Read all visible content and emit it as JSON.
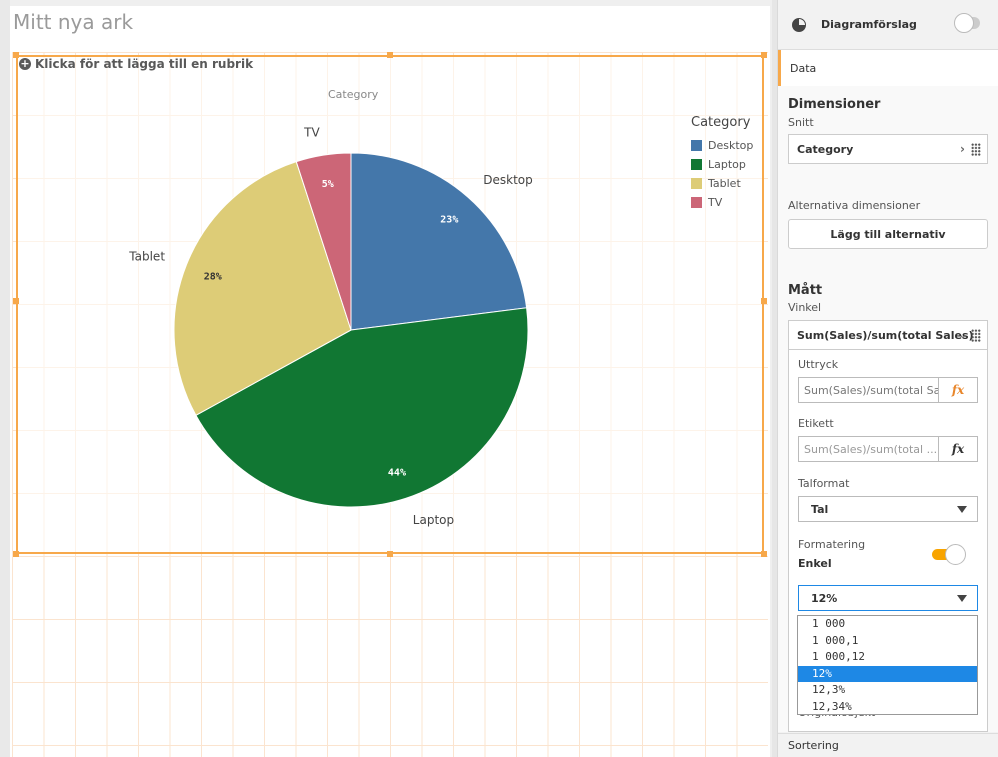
{
  "sheet": {
    "title": "Mitt nya ark"
  },
  "chart": {
    "add_title_label": "Klicka för att lägga till en rubrik",
    "dimension_label": "Category",
    "legend_title": "Category"
  },
  "chart_data": {
    "type": "pie",
    "title": "",
    "categories": [
      "Desktop",
      "Laptop",
      "Tablet",
      "TV"
    ],
    "values": [
      23,
      44,
      28,
      5
    ],
    "value_labels": [
      "23%",
      "44%",
      "28%",
      "5%"
    ],
    "colors": [
      "#4477aa",
      "#117733",
      "#ddcc77",
      "#cc6677"
    ],
    "legend_placement": "top-right"
  },
  "panel": {
    "suggestions_label": "Diagramförslag",
    "data_tab": "Data",
    "dimensions_heading": "Dimensioner",
    "dimensions_sub": "Snitt",
    "dimension_value": "Category",
    "alt_dimensions_label": "Alternativa dimensioner",
    "add_alt_button": "Lägg till alternativ",
    "measures_heading": "Mått",
    "measures_sub": "Vinkel",
    "measure_value": "Sum(Sales)/sum(total Sales)",
    "expression_label": "Uttryck",
    "expression_value": "Sum(Sales)/sum(total Sa",
    "label_label": "Etikett",
    "label_placeholder": "Sum(Sales)/sum(total ...",
    "fx": "fx",
    "number_format_label": "Talformat",
    "number_format_value": "Tal",
    "formatting_label": "Formatering",
    "formatting_mode": "Enkel",
    "format_selected": "12%",
    "format_options": [
      "1 000",
      "1 000,1",
      "1 000,12",
      "12%",
      "12,3%",
      "12,34%"
    ],
    "original_object": "Originalobjekt",
    "sorting": "Sortering"
  }
}
